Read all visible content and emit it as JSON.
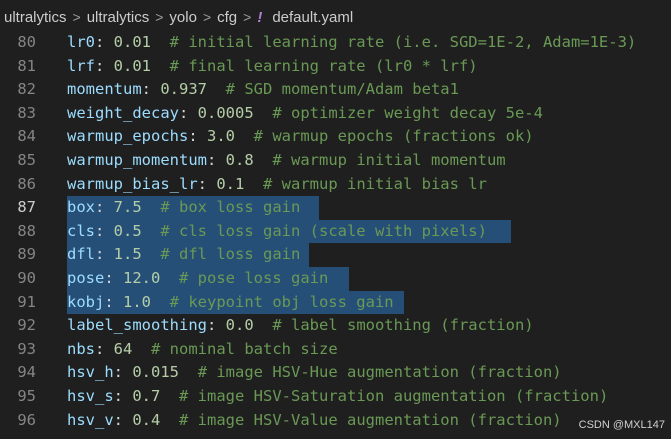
{
  "breadcrumb": {
    "items": [
      "ultralytics",
      "ultralytics",
      "yolo",
      "cfg"
    ],
    "separator": ">",
    "file_icon": "!",
    "file_name": "default.yaml"
  },
  "lines": [
    {
      "number": "80",
      "key": "lr0",
      "value": "0.01",
      "gap": "  ",
      "comment": "# initial learning rate (i.e. SGD=1E-2, Adam=1E-3)",
      "selected": false
    },
    {
      "number": "81",
      "key": "lrf",
      "value": "0.01",
      "gap": "  ",
      "comment": "# final learning rate (lr0 * lrf)",
      "selected": false
    },
    {
      "number": "82",
      "key": "momentum",
      "value": "0.937",
      "gap": "  ",
      "comment": "# SGD momentum/Adam beta1",
      "selected": false
    },
    {
      "number": "83",
      "key": "weight_decay",
      "value": "0.0005",
      "gap": "  ",
      "comment": "# optimizer weight decay 5e-4",
      "selected": false
    },
    {
      "number": "84",
      "key": "warmup_epochs",
      "value": "3.0",
      "gap": "  ",
      "comment": "# warmup epochs (fractions ok)",
      "selected": false
    },
    {
      "number": "85",
      "key": "warmup_momentum",
      "value": "0.8",
      "gap": "  ",
      "comment": "# warmup initial momentum",
      "selected": false
    },
    {
      "number": "86",
      "key": "warmup_bias_lr",
      "value": "0.1",
      "gap": "  ",
      "comment": "# warmup initial bias lr",
      "selected": false
    },
    {
      "number": "87",
      "key": "box",
      "value": "7.5",
      "gap": "  ",
      "comment": "# box loss gain",
      "selected": true,
      "active": true
    },
    {
      "number": "88",
      "key": "cls",
      "value": "0.5",
      "gap": "  ",
      "comment": "# cls loss gain (scale with pixels)",
      "selected": true
    },
    {
      "number": "89",
      "key": "dfl",
      "value": "1.5",
      "gap": "  ",
      "comment": "# dfl loss gain",
      "selected": true
    },
    {
      "number": "90",
      "key": "pose",
      "value": "12.0",
      "gap": "  ",
      "comment": "# pose loss gain",
      "selected": true
    },
    {
      "number": "91",
      "key": "kobj",
      "value": "1.0",
      "gap": "  ",
      "comment": "# keypoint obj loss gain",
      "selected": true
    },
    {
      "number": "92",
      "key": "label_smoothing",
      "value": "0.0",
      "gap": "  ",
      "comment": "# label smoothing (fraction)",
      "selected": false
    },
    {
      "number": "93",
      "key": "nbs",
      "value": "64",
      "gap": "  ",
      "comment": "# nominal batch size",
      "selected": false
    },
    {
      "number": "94",
      "key": "hsv_h",
      "value": "0.015",
      "gap": "  ",
      "comment": "# image HSV-Hue augmentation (fraction)",
      "selected": false
    },
    {
      "number": "95",
      "key": "hsv_s",
      "value": "0.7",
      "gap": "  ",
      "comment": "# image HSV-Saturation augmentation (fraction)",
      "selected": false
    },
    {
      "number": "96",
      "key": "hsv_v",
      "value": "0.4",
      "gap": "  ",
      "comment": "# image HSV-Value augmentation (fraction)",
      "selected": false
    }
  ],
  "watermark": "CSDN @MXL147",
  "colors": {
    "background": "#1f1f1f",
    "key": "#9cdcfe",
    "number": "#b5cea8",
    "comment": "#6a9955",
    "selection": "#264f78",
    "line_number": "#858585"
  }
}
